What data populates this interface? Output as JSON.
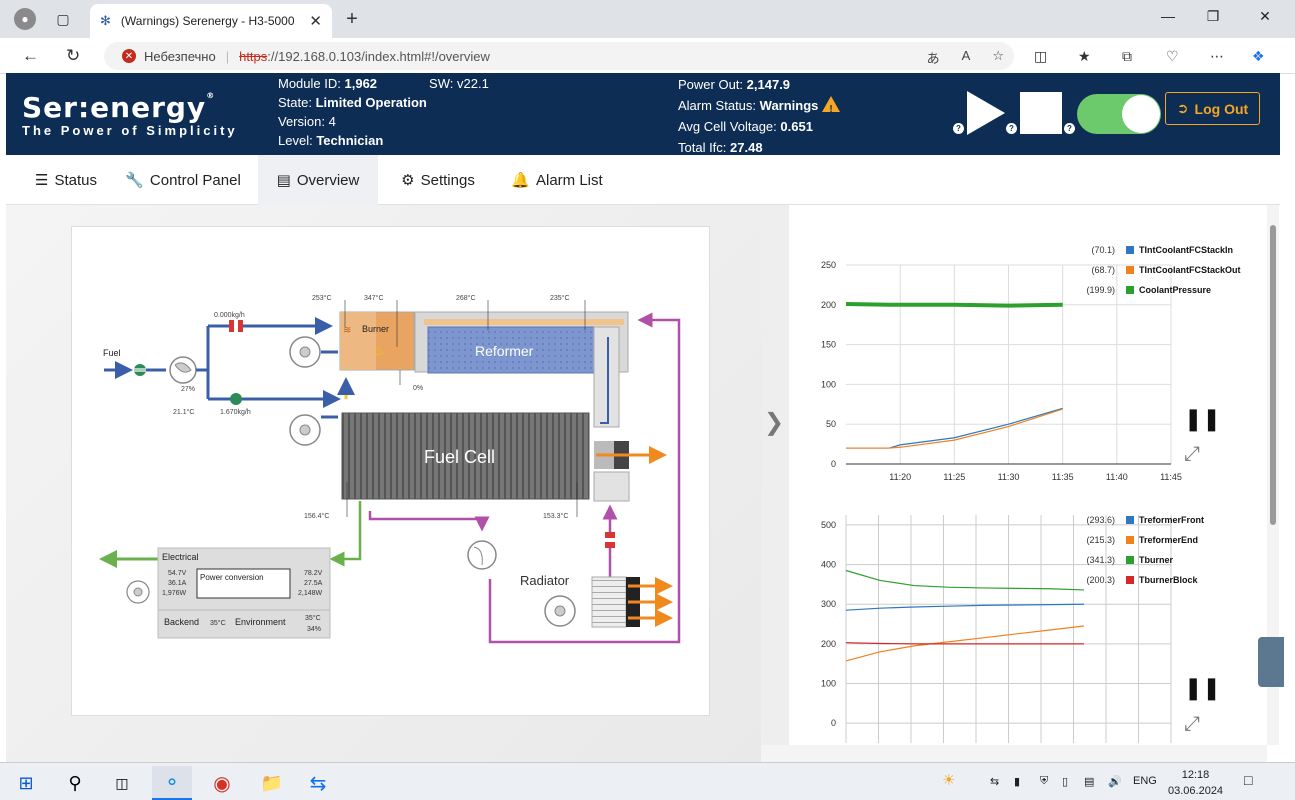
{
  "browser": {
    "tab_title": "(Warnings) Serenergy - H3-5000",
    "security_label": "Небезпечно",
    "url_protocol": "https",
    "url_rest": "://192.168.0.103/index.html#!/overview",
    "read_aloud": "A"
  },
  "header": {
    "logo_text": "Ser:energy",
    "logo_mark": "®",
    "tagline": "The Power of Simplicity",
    "module_id_label": "Module ID:",
    "module_id": "1,962",
    "sw_label": "SW:",
    "sw": "v22.1",
    "state_label": "State:",
    "state": "Limited Operation",
    "version_label": "Version:",
    "version": "4",
    "level_label": "Level:",
    "level": "Technician",
    "power_out_label": "Power Out:",
    "power_out": "2,147.9",
    "alarm_label": "Alarm Status:",
    "alarm": "Warnings",
    "avg_cell_label": "Avg Cell Voltage:",
    "avg_cell": "0.651",
    "total_ifc_label": "Total Ifc:",
    "total_ifc": "27.48",
    "help": "?",
    "logout": "Log Out",
    "toggle_on": true
  },
  "nav": {
    "tabs": [
      "Status",
      "Control Panel",
      "Overview",
      "Settings",
      "Alarm List"
    ],
    "active": "Overview"
  },
  "diagram": {
    "fuel": "Fuel",
    "flow1": "0.000kg/h",
    "flow2": "1.670kg/h",
    "blower_pct": "27%",
    "fuel_temp": "21.1°C",
    "burner": "Burner",
    "burner_t1": "253°C",
    "burner_t2": "347°C",
    "reformer": "Reformer",
    "reformer_t1": "268°C",
    "reformer_t2": "235°C",
    "burner_pct": "0%",
    "fuel_cell": "Fuel Cell",
    "fc_in_temp": "156.4°C",
    "fc_out_temp": "153.3°C",
    "radiator": "Radiator",
    "electrical": "Electrical",
    "el_v": "54.7V",
    "el_a": "36.1A",
    "el_w": "1,976W",
    "power_conversion": "Power conversion",
    "pc_v": "78.2V",
    "pc_a": "27.5A",
    "pc_w": "2,148W",
    "backend": "Backend",
    "backend_t": "35°C",
    "environment": "Environment",
    "env_t": "35°C",
    "env_h": "34%"
  },
  "chart_data": [
    {
      "type": "line",
      "x_ticks": [
        "11:20",
        "11:25",
        "11:30",
        "11:35",
        "11:40",
        "11:45"
      ],
      "x": [
        "11:15",
        "11:19",
        "11:20",
        "11:25",
        "11:30",
        "11:35"
      ],
      "ylim": [
        0,
        250
      ],
      "y_ticks": [
        0,
        50,
        100,
        150,
        200,
        250
      ],
      "grid": true,
      "legend_position": "top-right",
      "series": [
        {
          "name": "TIntCoolantFCStackIn",
          "current": "(70.1)",
          "color": "#2f78c0",
          "values": [
            20,
            20,
            24,
            33,
            50,
            70
          ]
        },
        {
          "name": "TIntCoolantFCStackOut",
          "current": "(68.7)",
          "color": "#f0821e",
          "values": [
            20,
            20,
            21,
            30,
            47,
            69
          ]
        },
        {
          "name": "CoolantPressure",
          "current": "(199.9)",
          "color": "#2ca02c",
          "values": [
            201,
            200,
            200,
            200,
            199,
            200
          ]
        }
      ]
    },
    {
      "type": "line",
      "ylim": [
        -50,
        525
      ],
      "y_ticks": [
        0,
        100,
        200,
        300,
        400,
        500
      ],
      "grid": true,
      "legend_position": "top-right",
      "series": [
        {
          "name": "TreformerFront",
          "current": "(293.6)",
          "color": "#2f78c0",
          "values": [
            285,
            290,
            293,
            295,
            297,
            298,
            299,
            300
          ]
        },
        {
          "name": "TreformerEnd",
          "current": "(215.3)",
          "color": "#f0821e",
          "values": [
            157,
            180,
            195,
            205,
            215,
            225,
            235,
            245
          ]
        },
        {
          "name": "Tburner",
          "current": "(341.3)",
          "color": "#2ca02c",
          "values": [
            385,
            360,
            347,
            343,
            341,
            340,
            339,
            336
          ]
        },
        {
          "name": "TburnerBlock",
          "current": "(200.3)",
          "color": "#d62728",
          "values": [
            203,
            201,
            200,
            200,
            200,
            200,
            200,
            200
          ]
        }
      ]
    }
  ],
  "taskbar": {
    "lang": "ENG",
    "time": "12:18",
    "date": "03.06.2024"
  }
}
